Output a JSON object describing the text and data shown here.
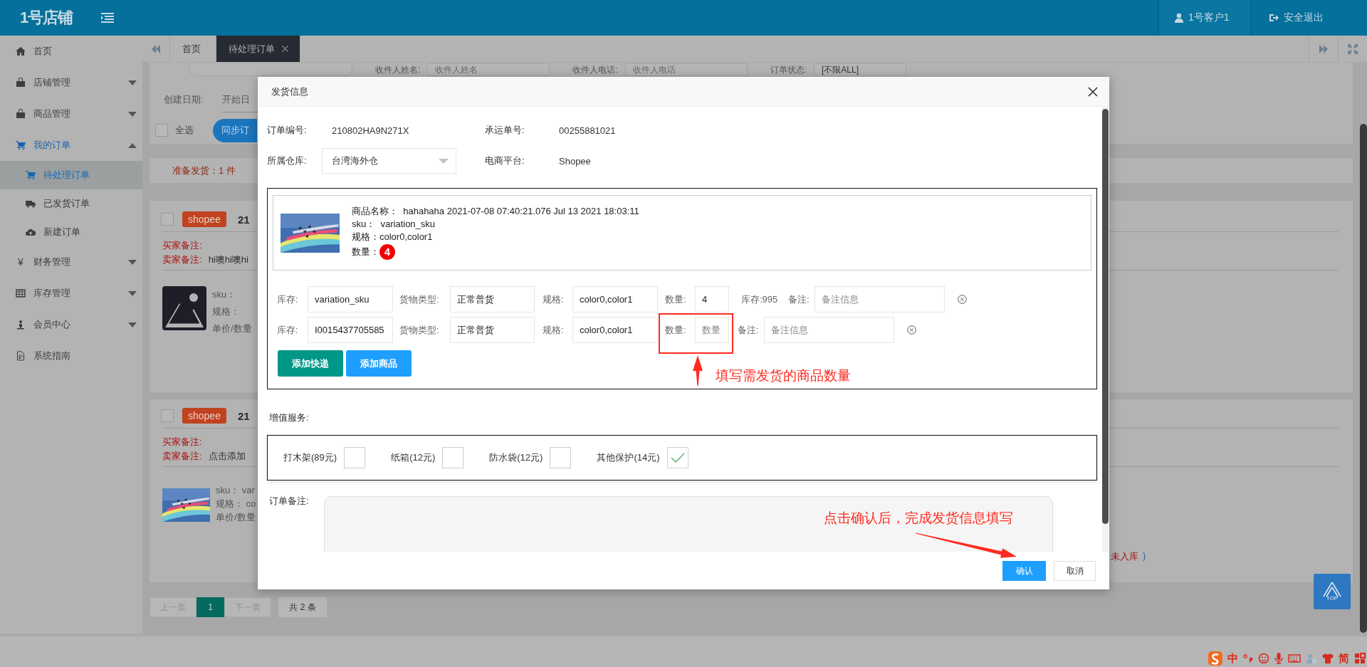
{
  "header": {
    "logo": "1号店铺",
    "user": "1号客户1",
    "logout": "安全退出"
  },
  "sidebar": [
    {
      "label": "首页",
      "selected": false
    },
    {
      "label": "店铺管理",
      "selected": false,
      "expanded": false
    },
    {
      "label": "商品管理",
      "selected": false,
      "expanded": false
    },
    {
      "label": "我的订单",
      "selected": false,
      "expanded": true,
      "children": [
        {
          "label": "待处理订单",
          "selected": true
        },
        {
          "label": "已发货订单",
          "selected": false
        },
        {
          "label": "新建订单",
          "selected": false
        }
      ]
    },
    {
      "label": "财务管理",
      "icon_text": "¥",
      "selected": false,
      "expanded": false
    },
    {
      "label": "库存管理",
      "selected": false,
      "expanded": false
    },
    {
      "label": "会员中心",
      "selected": false,
      "expanded": false
    },
    {
      "label": "系统指南",
      "selected": false
    }
  ],
  "tabs": [
    {
      "label": "首页",
      "selected": false,
      "closable": false
    },
    {
      "label": "待处理订单",
      "selected": true,
      "closable": true
    }
  ],
  "filters": {
    "fields": [
      {
        "label": "收件人姓名:",
        "placeholder": "收件人姓名"
      },
      {
        "label": "收件人电话:",
        "placeholder": "收件人电话"
      },
      {
        "label": "订单状态:",
        "value": "[不限ALL]"
      }
    ],
    "date_label": "创建日期:",
    "date_start": "开始日",
    "select_all": {
      "label": "全选",
      "checked": false
    },
    "sync_button": "同步订"
  },
  "ready": "准备发货：1 件",
  "orders": [
    {
      "checked": false,
      "platform": "shopee",
      "number": "21",
      "buyer_note_label": "买家备注:",
      "seller_note_label": "卖家备注:",
      "seller_note": "hi噢hi噢hi",
      "kind": "placeholder",
      "lines": [
        "sku：",
        "规格：",
        "单价/数量"
      ]
    },
    {
      "checked": false,
      "platform": "shopee",
      "number": "21",
      "buyer_note_label": "买家备注:",
      "seller_note_label": "卖家备注:",
      "seller_note": "点击添加",
      "kind": "picture",
      "lines": [
        "sku：  var",
        "规格：  co",
        "单价/数量"
      ],
      "status": "未入库",
      "status_end": ")"
    }
  ],
  "pagination": {
    "prev": "上一页",
    "pages": [
      {
        "label": "1",
        "selected": true
      }
    ],
    "next": "下一页",
    "total": "共 2 条"
  },
  "back_to_top": "TOP",
  "dialog": {
    "title": "发货信息",
    "fields": [
      {
        "label": "订单编号:",
        "value": "210802HA9N271X",
        "kind": "text"
      },
      {
        "label": "承运单号:",
        "value": "00255881021",
        "kind": "text"
      },
      {
        "label": "所属仓库:",
        "value": "台湾海外仓",
        "kind": "select"
      },
      {
        "label": "电商平台:",
        "value": "Shopee",
        "kind": "text"
      }
    ],
    "product": {
      "lines": [
        "商品名称：  hahahaha 2021-07-08 07:40:21.076 Jul 13 2021 18:03:11",
        "sku：  variation_sku",
        "规格：color0,color1"
      ],
      "qty_label": "数量：",
      "qty": "4"
    },
    "shipments": [
      {
        "stock_label": "库存:",
        "stock": "variation_sku",
        "type_label": "货物类型:",
        "type": "正常普货",
        "spec_label": "规格:",
        "spec": "color0,color1",
        "qty_label": "数量:",
        "qty": "4",
        "inventory": "库存:995",
        "note_label": "备注:",
        "note_placeholder": "备注信息"
      },
      {
        "stock_label": "库存:",
        "stock": "I0015437705585",
        "type_label": "货物类型:",
        "type": "正常普货",
        "spec_label": "规格:",
        "spec": "color0,color1",
        "qty_label": "数量:",
        "qty_placeholder": "数量",
        "note_label": "备注:",
        "note_placeholder": "备注信息"
      }
    ],
    "add_express": "添加快递",
    "add_product": "添加商品",
    "services_label": "增值服务:",
    "services": [
      {
        "label": "打木架(89元)",
        "checked": false
      },
      {
        "label": "纸箱(12元)",
        "checked": false
      },
      {
        "label": "防水袋(12元)",
        "checked": false
      },
      {
        "label": "其他保护(14元)",
        "checked": true
      }
    ],
    "remark_label": "订单备注:",
    "confirm": "确认",
    "cancel": "取消"
  },
  "annotations": [
    {
      "text": "填写需发货的商品数量"
    },
    {
      "text": "点击确认后，完成发货信息填写"
    }
  ],
  "ime": {
    "lang": "中",
    "script": "简"
  }
}
